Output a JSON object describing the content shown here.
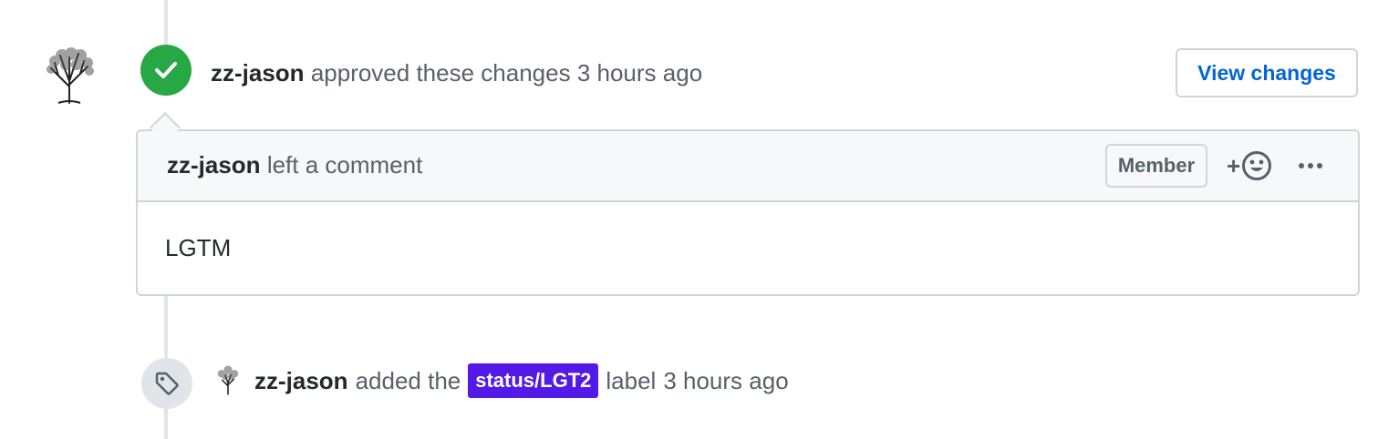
{
  "review": {
    "author": "zz-jason",
    "action_text": "approved these changes",
    "time": "3 hours ago",
    "view_changes_label": "View changes"
  },
  "comment": {
    "author": "zz-jason",
    "action_text": "left a comment",
    "role_badge": "Member",
    "body": "LGTM"
  },
  "label_event": {
    "author": "zz-jason",
    "action_text": "added the",
    "label_name": "status/LGT2",
    "label_color": "#5319e7",
    "suffix_text": "label",
    "time": "3 hours ago"
  },
  "icons": {
    "approved": "check-icon",
    "tag": "tag-icon",
    "reaction": "smiley-icon",
    "more": "kebab-horizontal-icon"
  },
  "colors": {
    "approved_green": "#28a745",
    "link_blue": "#0366d6",
    "muted": "#586069"
  }
}
